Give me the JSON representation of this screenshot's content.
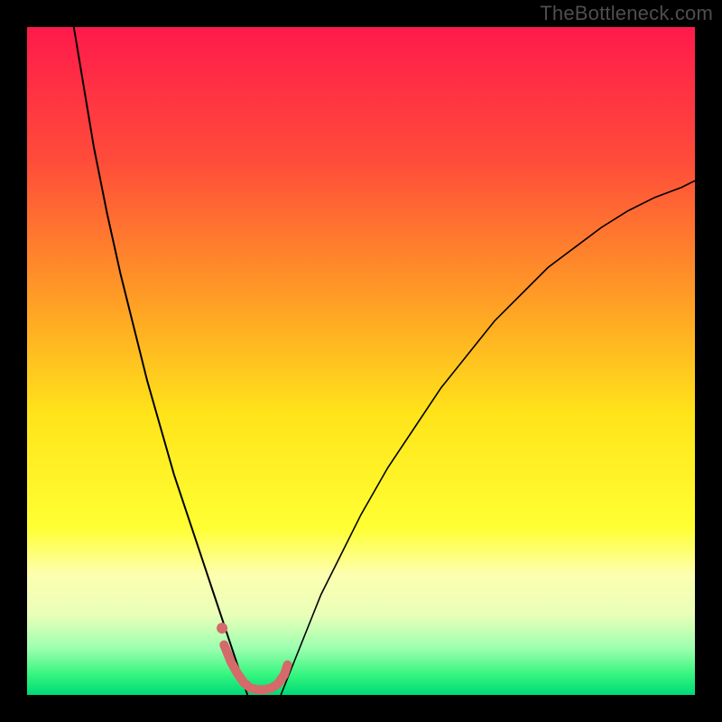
{
  "watermark": "TheBottleneck.com",
  "chart_data": {
    "type": "line",
    "title": "",
    "xlabel": "",
    "ylabel": "",
    "xlim": [
      0,
      100
    ],
    "ylim": [
      0,
      100
    ],
    "grid": false,
    "legend": false,
    "background_gradient": {
      "stops": [
        {
          "offset": 0.0,
          "color": "#ff1a4b"
        },
        {
          "offset": 0.2,
          "color": "#ff4c3a"
        },
        {
          "offset": 0.4,
          "color": "#ff9a26"
        },
        {
          "offset": 0.58,
          "color": "#ffe41a"
        },
        {
          "offset": 0.75,
          "color": "#ffff33"
        },
        {
          "offset": 0.82,
          "color": "#fdffb0"
        },
        {
          "offset": 0.88,
          "color": "#e9ffb8"
        },
        {
          "offset": 0.93,
          "color": "#9dffb0"
        },
        {
          "offset": 0.97,
          "color": "#34f57e"
        },
        {
          "offset": 1.0,
          "color": "#00d977"
        }
      ]
    },
    "series": [
      {
        "name": "left-curve",
        "stroke": "#000000",
        "stroke_width": 2.0,
        "x": [
          7,
          8,
          9,
          10,
          12,
          14,
          16,
          18,
          20,
          22,
          24,
          26,
          28,
          29,
          30,
          31,
          32,
          33
        ],
        "y": [
          100,
          94,
          88,
          82,
          72,
          63,
          55,
          47,
          40,
          33,
          27,
          21,
          15,
          12,
          9,
          6,
          3,
          0
        ]
      },
      {
        "name": "right-curve",
        "stroke": "#000000",
        "stroke_width": 1.6,
        "x": [
          38,
          40,
          42,
          44,
          47,
          50,
          54,
          58,
          62,
          66,
          70,
          74,
          78,
          82,
          86,
          90,
          94,
          98,
          100
        ],
        "y": [
          0,
          5,
          10,
          15,
          21,
          27,
          34,
          40,
          46,
          51,
          56,
          60,
          64,
          67,
          70,
          72.5,
          74.5,
          76,
          77
        ]
      },
      {
        "name": "marker-trail",
        "stroke": "#d46a6a",
        "stroke_width": 10,
        "marker": "round",
        "x": [
          29.5,
          30.5,
          31.5,
          32.5,
          33.5,
          34.5,
          35.5,
          36.5,
          37.5,
          38.5,
          39.0
        ],
        "y": [
          7.5,
          5.0,
          3.2,
          1.8,
          1.0,
          0.8,
          0.8,
          1.0,
          1.6,
          3.0,
          4.5
        ]
      },
      {
        "name": "marker-dot",
        "stroke": "#d46a6a",
        "marker": "circle",
        "x": [
          29.2
        ],
        "y": [
          10.0
        ]
      }
    ]
  }
}
